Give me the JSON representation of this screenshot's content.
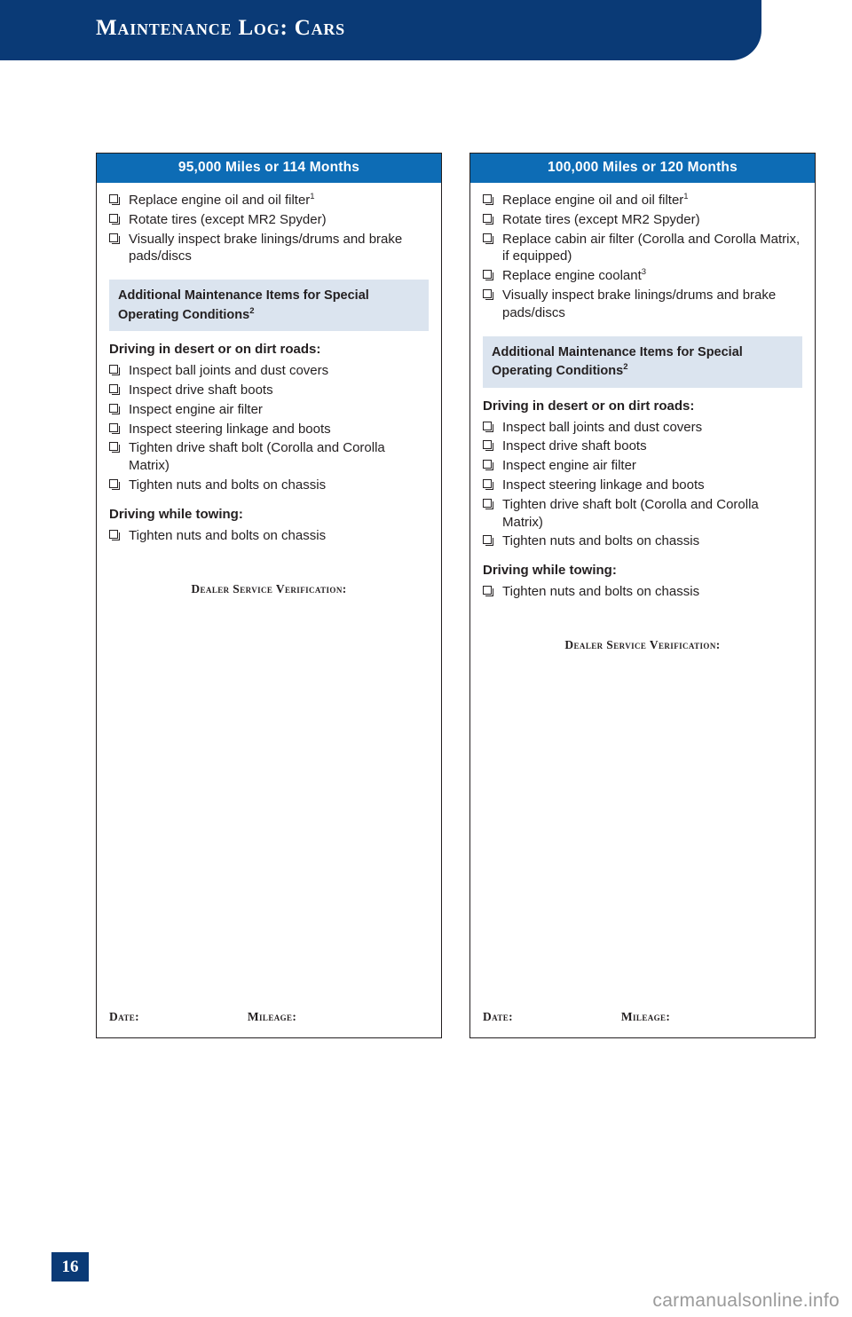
{
  "header": {
    "title": "Maintenance Log: Cars"
  },
  "columns": [
    {
      "title": "95,000 Miles or 114 Months",
      "items": [
        {
          "text": "Replace engine oil and oil filter",
          "sup": "1"
        },
        {
          "text": "Rotate tires (except MR2 Spyder)",
          "sup": ""
        },
        {
          "text": "Visually inspect brake linings/drums and brake pads/discs",
          "sup": ""
        }
      ],
      "special_band": "Additional Maintenance Items for Special Operating Conditions",
      "special_band_sup": "2",
      "desert_head": "Driving in desert or on dirt roads:",
      "desert_items": [
        {
          "text": "Inspect ball joints and dust covers",
          "sup": ""
        },
        {
          "text": "Inspect drive shaft boots",
          "sup": ""
        },
        {
          "text": "Inspect engine air filter",
          "sup": ""
        },
        {
          "text": "Inspect steering linkage and boots",
          "sup": ""
        },
        {
          "text": "Tighten drive shaft bolt (Corolla and Corolla Matrix)",
          "sup": ""
        },
        {
          "text": "Tighten nuts and bolts on chassis",
          "sup": ""
        }
      ],
      "towing_head": "Driving while towing:",
      "towing_items": [
        {
          "text": "Tighten nuts and bolts on chassis",
          "sup": ""
        }
      ],
      "dealer_verification": "Dealer Service Verification:",
      "date_label": "Date:",
      "mileage_label": "Mileage:"
    },
    {
      "title": "100,000 Miles or 120 Months",
      "items": [
        {
          "text": "Replace engine oil and oil filter",
          "sup": "1"
        },
        {
          "text": "Rotate tires (except MR2 Spyder)",
          "sup": ""
        },
        {
          "text": "Replace cabin air filter (Corolla and Corolla Matrix, if equipped)",
          "sup": ""
        },
        {
          "text": "Replace engine coolant",
          "sup": "3"
        },
        {
          "text": "Visually inspect brake linings/drums and brake pads/discs",
          "sup": ""
        }
      ],
      "special_band": "Additional Maintenance Items for Special Operating Conditions",
      "special_band_sup": "2",
      "desert_head": "Driving in desert or on dirt roads:",
      "desert_items": [
        {
          "text": "Inspect ball joints and dust covers",
          "sup": ""
        },
        {
          "text": "Inspect drive shaft boots",
          "sup": ""
        },
        {
          "text": "Inspect engine air filter",
          "sup": ""
        },
        {
          "text": "Inspect steering linkage and boots",
          "sup": ""
        },
        {
          "text": "Tighten drive shaft bolt (Corolla and Corolla Matrix)",
          "sup": ""
        },
        {
          "text": "Tighten nuts and bolts on chassis",
          "sup": ""
        }
      ],
      "towing_head": "Driving while towing:",
      "towing_items": [
        {
          "text": "Tighten nuts and bolts on chassis",
          "sup": ""
        }
      ],
      "dealer_verification": "Dealer Service Verification:",
      "date_label": "Date:",
      "mileage_label": "Mileage:"
    }
  ],
  "page_number": "16",
  "watermark": "carmanualsonline.info",
  "colors": {
    "header_blue": "#0a3a76",
    "title_blue": "#0d6cb5",
    "band_grey": "#dbe4ef",
    "ink": "#231f20"
  }
}
